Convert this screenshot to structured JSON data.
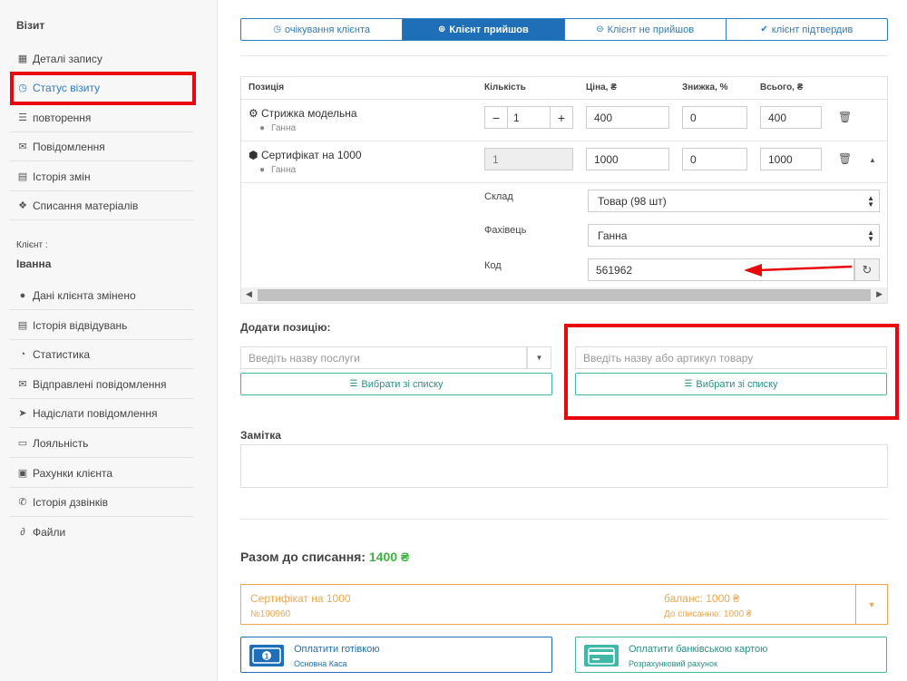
{
  "sidebar": {
    "visit_heading": "Візит",
    "visit_items": [
      {
        "label": "Деталі запису",
        "icon": "calendar-icon",
        "glyph": "▦"
      },
      {
        "label": "Статус візиту",
        "icon": "clock-icon",
        "glyph": "◷"
      },
      {
        "label": "повторення",
        "icon": "list-icon",
        "glyph": "☰"
      },
      {
        "label": "Повідомлення",
        "icon": "comments-icon",
        "glyph": "✉"
      },
      {
        "label": "Історія змін",
        "icon": "file-icon",
        "glyph": "▤"
      },
      {
        "label": "Списання матеріалів",
        "icon": "cubes-icon",
        "glyph": "❖"
      }
    ],
    "client_label": "Клієнт :",
    "client_name": "Іванна",
    "client_items": [
      {
        "label": "Дані клієнта змінено",
        "icon": "user-icon",
        "glyph": "●"
      },
      {
        "label": "Історія відвідувань",
        "icon": "list-alt-icon",
        "glyph": "▤"
      },
      {
        "label": "Статистика",
        "icon": "pie-chart-icon",
        "glyph": "◔"
      },
      {
        "label": "Відправлені повідомлення",
        "icon": "envelope-icon",
        "glyph": "✉"
      },
      {
        "label": "Надіслати повідомлення",
        "icon": "send-icon",
        "glyph": "➤"
      },
      {
        "label": "Лояльність",
        "icon": "credit-card-icon",
        "glyph": "▭"
      },
      {
        "label": "Рахунки клієнта",
        "icon": "briefcase-icon",
        "glyph": "▣"
      },
      {
        "label": "Історія дзвінків",
        "icon": "phone-icon",
        "glyph": "✆"
      },
      {
        "label": "Файли",
        "icon": "paperclip-icon",
        "glyph": "∂"
      }
    ]
  },
  "tabs": [
    {
      "label": "очікування клієнта",
      "icon": "clock-icon",
      "glyph": "◷"
    },
    {
      "label": "Клієнт прийшов",
      "icon": "plus-circle-icon",
      "glyph": "⊕"
    },
    {
      "label": "Клієнт не прийшов",
      "icon": "minus-circle-icon",
      "glyph": "⊖"
    },
    {
      "label": "клієнт підтвердив",
      "icon": "check-circle-icon",
      "glyph": "✔"
    }
  ],
  "table": {
    "headers": {
      "position": "Позиція",
      "qty": "Кількість",
      "price": "Ціна, ₴",
      "discount": "Знижка, %",
      "total": "Всього, ₴"
    },
    "rows": [
      {
        "name": "Стрижка модельна",
        "icon": "cog-icon",
        "glyph": "⚙",
        "employee": "Ганна",
        "qty": "1",
        "price": "400",
        "discount": "0",
        "total": "400"
      },
      {
        "name": "Сертифікат на 1000",
        "icon": "cube-icon",
        "glyph": "⬢",
        "employee": "Ганна",
        "qty": "1",
        "price": "1000",
        "discount": "0",
        "total": "1000"
      }
    ],
    "details": {
      "warehouse_label": "Склад",
      "warehouse_value": "Товар (98 шт)",
      "specialist_label": "Фахівець",
      "specialist_value": "Ганна",
      "code_label": "Код",
      "code_value": "561962"
    }
  },
  "add_position": {
    "title": "Додати позицію:",
    "service_placeholder": "Введіть назву послуги",
    "product_placeholder": "Введіть назву або артикул товару",
    "choose_list_label": "Вибрати зі списку"
  },
  "note": {
    "title": "Замітка"
  },
  "summary": {
    "label": "Разом до списання:",
    "amount": "1400 ₴"
  },
  "certificate": {
    "name": "Сертифікат на 1000",
    "number": "№190960",
    "balance": "баланс: 1000 ₴",
    "to_charge": "До списанню: 1000 ₴"
  },
  "payments": {
    "cash": {
      "title": "Оплатити готівкою",
      "sub": "Основна Каса"
    },
    "card": {
      "title": "Оплатити банківською картою",
      "sub": "Розрахунковий рахунок"
    }
  },
  "colors": {
    "accent": "#1f6eb8",
    "teal": "#3fb8a8",
    "highlight_red": "#e8070c",
    "orange": "#f0a74d",
    "green": "#3fb33f"
  }
}
